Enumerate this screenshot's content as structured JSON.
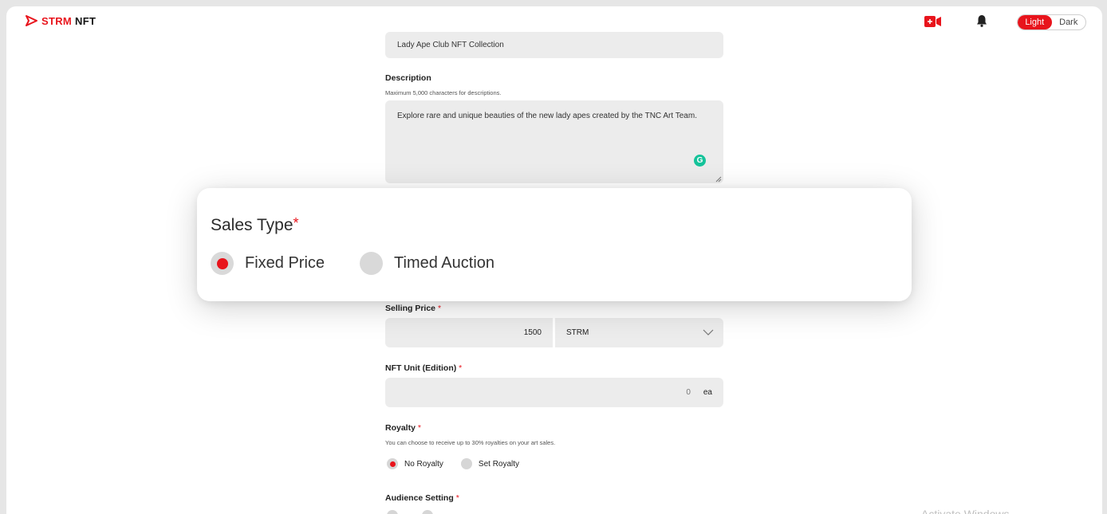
{
  "header": {
    "logo_part1": "STRM",
    "logo_part2": "NFT",
    "theme": {
      "light_label": "Light",
      "dark_label": "Dark",
      "selected": "Light"
    }
  },
  "form": {
    "collection_name_value": "Lady Ape Club NFT Collection",
    "description": {
      "label": "Description",
      "hint": "Maximum 5,000 characters for descriptions.",
      "value": "Explore rare and unique beauties of the new lady apes created by the TNC Art Team.",
      "grammarly_glyph": "G"
    },
    "selling_price": {
      "label": "Selling Price",
      "required_mark": "*",
      "value": "1500",
      "currency": "STRM"
    },
    "nft_unit": {
      "label": "NFT Unit (Edition)",
      "required_mark": "*",
      "value": "0",
      "unit": "ea"
    },
    "royalty": {
      "label": "Royalty",
      "required_mark": "*",
      "hint": "You can choose to receive up to 30% royalties on your art sales.",
      "options": [
        "No Royalty",
        "Set Royalty"
      ],
      "selected": "No Royalty"
    },
    "audience": {
      "label": "Audience Setting",
      "required_mark": "*"
    }
  },
  "popup": {
    "title": "Sales Type",
    "required_mark": "*",
    "options": [
      "Fixed Price",
      "Timed Auction"
    ],
    "selected": "Fixed Price"
  },
  "os_watermark": "Activate Windows",
  "colors": {
    "accent": "#e8141c",
    "field_bg": "#ececec",
    "radio_idle": "#d9d9d9",
    "grammarly": "#15c39a"
  },
  "icons": [
    "logo-play-icon",
    "live-video-icon",
    "bell-icon",
    "chevron-down-icon",
    "resize-handle-icon",
    "grammarly-icon"
  ]
}
